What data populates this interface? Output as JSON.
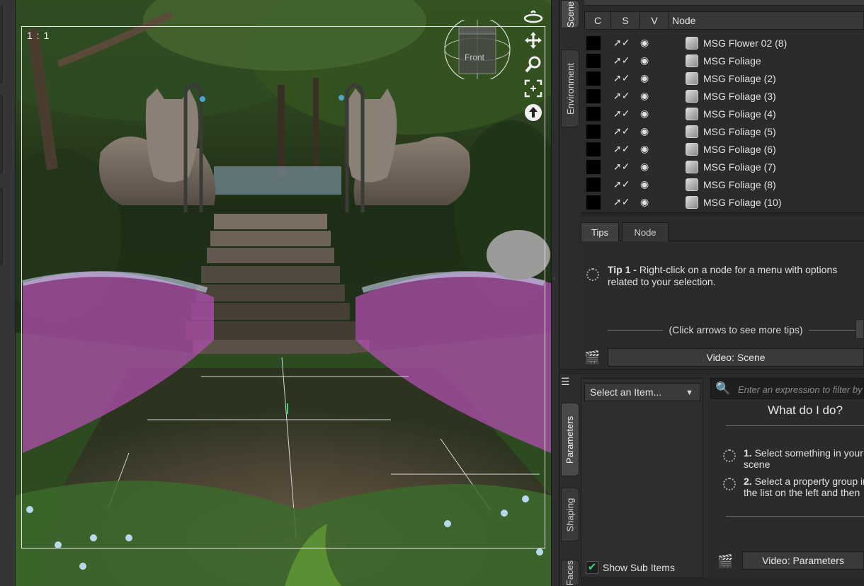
{
  "viewport": {
    "ratio_label": "1 : 1",
    "cube_label": "Front"
  },
  "side_tabs_top": [
    {
      "label": "Scene"
    },
    {
      "label": "Environment"
    }
  ],
  "side_tabs_bottom": [
    {
      "label": "Parameters"
    },
    {
      "label": "Shaping"
    },
    {
      "label": "Faces"
    }
  ],
  "scene": {
    "columns": {
      "c": "C",
      "s": "S",
      "v": "V",
      "node": "Node"
    },
    "rows": [
      {
        "label": "MSG Flower 02 (8)"
      },
      {
        "label": "MSG Foliage"
      },
      {
        "label": "MSG Foliage (2)"
      },
      {
        "label": "MSG Foliage (3)"
      },
      {
        "label": "MSG Foliage (4)"
      },
      {
        "label": "MSG Foliage (5)"
      },
      {
        "label": "MSG Foliage (6)"
      },
      {
        "label": "MSG Foliage (7)"
      },
      {
        "label": "MSG Foliage (8)"
      },
      {
        "label": "MSG Foliage (10)"
      }
    ]
  },
  "tips": {
    "tabs": [
      "Tips",
      "Node"
    ],
    "tip_title": "Tip 1 -",
    "tip_body": "Right-click on a node for a menu with options related to your selection.",
    "hint": "(Click arrows to see more tips)",
    "video_label": "Video: Scene"
  },
  "params": {
    "select_label": "Select an Item...",
    "filter_placeholder": "Enter an expression to filter by",
    "heading": "What do I do?",
    "step1_num": "1.",
    "step1_text": "Select something in your scene",
    "step2_num": "2.",
    "step2_text": "Select a property group in the list on the left and then",
    "show_sub_label": "Show Sub Items",
    "video_label": "Video: Parameters"
  },
  "icons": {
    "orbit": "orbit-icon",
    "pan": "pan-icon",
    "zoom": "zoom-icon",
    "frame": "frame-icon",
    "up": "up-arrow-icon",
    "select": "select-arrow-icon",
    "visible": "eye-icon",
    "node": "node-cube-icon",
    "video": "clapperboard-icon",
    "filter": "magnifier-icon"
  }
}
